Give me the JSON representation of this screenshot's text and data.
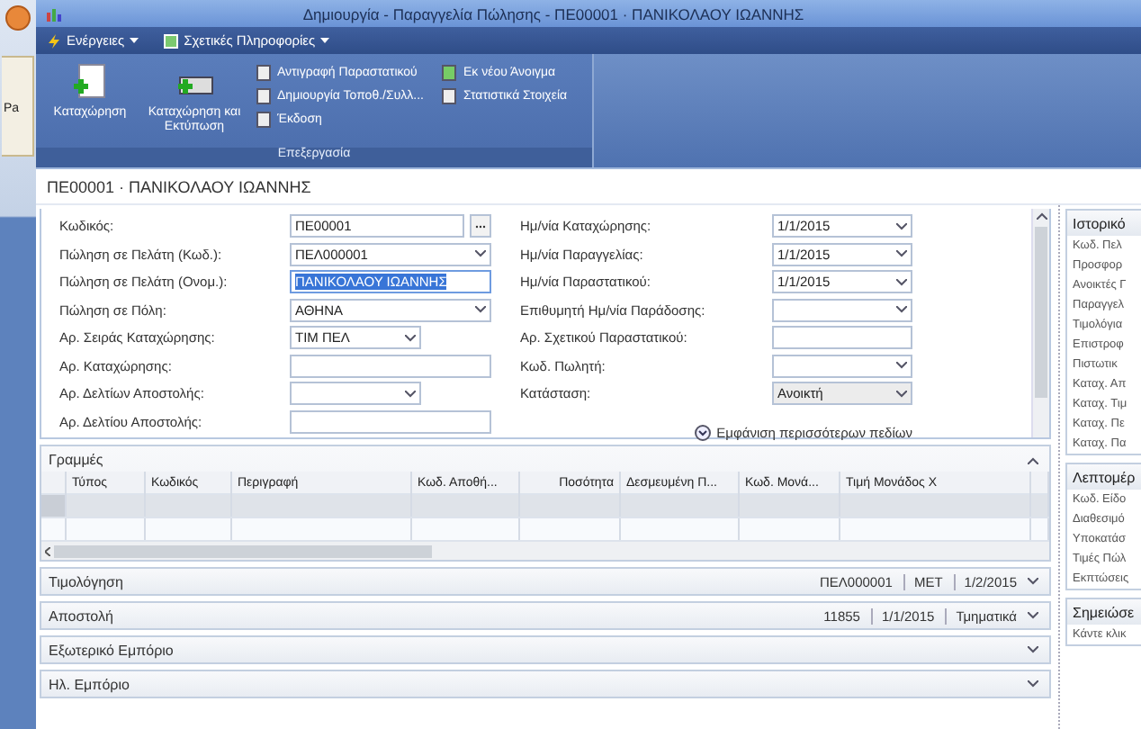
{
  "outer_app": {
    "button_label": "Pa"
  },
  "window": {
    "title": "Δημιουργία - Παραγγελία Πώλησης - ΠΕ00001 · ΠΑΝΙΚΟΛΑΟΥ ΙΩΑΝΝΗΣ"
  },
  "menu": [
    "Ενέργειες",
    "Σχετικές Πληροφορίες"
  ],
  "ribbon": {
    "group": "Επεξεργασία",
    "large_buttons": [
      "Καταχώρηση",
      "Καταχώρηση και Εκτύπωση"
    ],
    "small_buttons": [
      [
        "Αντιγραφή Παραστατικού",
        "Δημιουργία Τοποθ./Συλλ...",
        "Έκδοση"
      ],
      [
        "Εκ νέου Άνοιγμα",
        "Στατιστικά Στοιχεία"
      ]
    ]
  },
  "header": "ΠΕ00001 · ΠΑΝΙΚΟΛΑΟΥ ΙΩΑΝΝΗΣ",
  "fields_left": [
    {
      "label": "Κωδικός:",
      "kind": "lookup",
      "value": "ΠΕ00001",
      "selected": false
    },
    {
      "label": "Πώληση σε Πελάτη (Κωδ.):",
      "kind": "dropdown",
      "value": "ΠΕΛ000001",
      "selected": false
    },
    {
      "label": "Πώληση σε Πελάτη (Ονομ.):",
      "kind": "text",
      "value": "ΠΑΝΙΚΟΛΑΟΥ ΙΩΑΝΝΗΣ",
      "selected": true
    },
    {
      "label": "Πώληση σε Πόλη:",
      "kind": "dropdown",
      "value": "ΑΘΗΝΑ",
      "selected": false
    },
    {
      "label": "Αρ. Σειράς Καταχώρησης:",
      "kind": "short_dropdown",
      "value": "ΤΙΜ ΠΕΛ",
      "selected": false
    },
    {
      "label": "Αρ. Καταχώρησης:",
      "kind": "text",
      "selected": false
    },
    {
      "label": "Αρ. Δελτίων Αποστολής:",
      "kind": "short_dropdown",
      "selected": false
    },
    {
      "label": "Αρ. Δελτίου Αποστολής:",
      "kind": "text",
      "selected": false
    }
  ],
  "fields_right": [
    {
      "label": "Ημ/νία Καταχώρησης:",
      "kind": "dropdown",
      "value": "1/1/2015",
      "disabled": false
    },
    {
      "label": "Ημ/νία Παραγγελίας:",
      "kind": "dropdown",
      "value": "1/1/2015",
      "disabled": false
    },
    {
      "label": "Ημ/νία Παραστατικού:",
      "kind": "dropdown",
      "value": "1/1/2015",
      "disabled": false
    },
    {
      "label": "Επιθυμητή Ημ/νία Παράδοσης:",
      "kind": "dropdown",
      "disabled": false
    },
    {
      "label": "Αρ. Σχετικού Παραστατικού:",
      "kind": "text",
      "disabled": false
    },
    {
      "label": "Κωδ. Πωλητή:",
      "kind": "dropdown",
      "disabled": false
    },
    {
      "label": "Κατάσταση:",
      "kind": "dropdown",
      "value": "Ανοικτή",
      "disabled": true
    }
  ],
  "more_fields_link": "Εμφάνιση περισσότερων πεδίων",
  "lines": {
    "title": "Γραμμές",
    "expanded": true,
    "columns": [
      "Τύπος",
      "Κωδικός",
      "Περιγραφή",
      "Κωδ. Αποθή...",
      "Ποσότητα",
      "Δεσμευμένη Π...",
      "Κωδ. Μονά...",
      "Τιμή Μονάδος Χ"
    ],
    "rows": [
      {
        "selected": true
      },
      {
        "selected": false
      }
    ]
  },
  "sections": [
    {
      "title": "Τιμολόγηση",
      "summary": [
        "ΠΕΛ000001",
        "ΜΕΤ",
        "1/2/2015"
      ],
      "expanded": false
    },
    {
      "title": "Αποστολή",
      "summary": [
        "11855",
        "1/1/2015",
        "Τμηματικά"
      ],
      "expanded": false
    },
    {
      "title": "Εξωτερικό Εμπόριο",
      "expanded": false
    },
    {
      "title": "Ηλ. Εμπόριο",
      "expanded": false
    }
  ],
  "factbox": [
    {
      "title": "Ιστορικό",
      "items": [
        "Κωδ. Πελ",
        "Προσφορ",
        "Ανοικτές Γ",
        "Παραγγελ",
        "Τιμολόγια",
        "Επιστροφ",
        "Πιστωτικ",
        "Καταχ. Απ",
        "Καταχ. Τιμ",
        "Καταχ. Πε",
        "Καταχ. Πα"
      ]
    },
    {
      "title": "Λεπτομέρ",
      "items": [
        "Κωδ. Είδο",
        "Διαθεσιμό",
        "Υποκατάσ",
        "Τιμές Πώλ",
        "Εκπτώσεις"
      ]
    },
    {
      "title": "Σημειώσε",
      "items": [
        "Κάντε κλικ"
      ]
    }
  ]
}
